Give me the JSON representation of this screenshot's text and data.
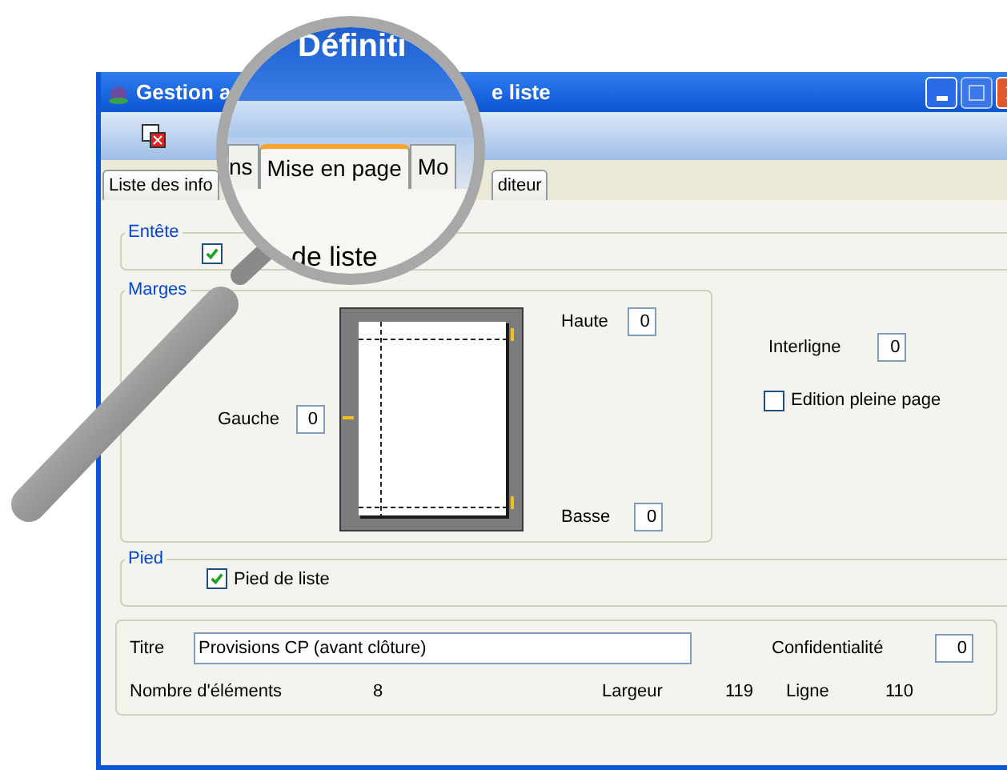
{
  "window": {
    "title_left": "Gestion a",
    "title_right": "e liste"
  },
  "tabs": [
    {
      "label": "Liste des info",
      "selected": false
    },
    {
      "label": "diteur",
      "selected": false
    }
  ],
  "header": {
    "legend": "Entête",
    "checked": true
  },
  "margins": {
    "legend": "Marges",
    "left_label": "Gauche",
    "left_value": "0",
    "top_label": "Haute",
    "top_value": "0",
    "bottom_label": "Basse",
    "bottom_value": "0"
  },
  "spacing": {
    "label": "Interligne",
    "value": "0"
  },
  "full_page": {
    "label": "Edition pleine page",
    "checked": false
  },
  "footer": {
    "legend": "Pied",
    "label": "Pied de liste",
    "checked": true
  },
  "details": {
    "title_label": "Titre",
    "title_value": "Provisions CP (avant clôture)",
    "confidentiality_label": "Confidentialité",
    "confidentiality_value": "0",
    "count_label": "Nombre d'éléments",
    "count_value": "8",
    "width_label": "Largeur",
    "width_value": "119",
    "line_label": "Ligne",
    "line_value": "110"
  },
  "magnifier": {
    "title": "Définiti",
    "header_label": "de liste",
    "tabs": [
      {
        "label": "ns",
        "selected": false
      },
      {
        "label": "Mise en page",
        "selected": true
      },
      {
        "label": "Mo",
        "selected": false
      }
    ]
  }
}
